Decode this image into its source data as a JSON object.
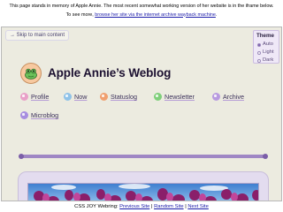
{
  "memorial": {
    "line1": "This page stands in memory of Apple Annie. The most recent somewhat working version of her website is in the iframe below.",
    "line2_prefix": "To see more, ",
    "line2_link": "browse her site via the internet archive wayback machine",
    "line2_suffix": "."
  },
  "site": {
    "skip_link": "Skip to main content",
    "title": "Apple Annie’s Weblog",
    "theme": {
      "title": "Theme",
      "options": [
        "Auto",
        "Light",
        "Dark"
      ],
      "selected": "Auto"
    },
    "nav": [
      {
        "label": "Profile",
        "icon": "profile-icon",
        "color": "#e9a0c8"
      },
      {
        "label": "Now",
        "icon": "now-icon",
        "color": "#8fc2e8"
      },
      {
        "label": "Statuslog",
        "icon": "statuslog-icon",
        "color": "#f0a070"
      },
      {
        "label": "Newsletter",
        "icon": "newsletter-icon",
        "color": "#7fcf7a"
      },
      {
        "label": "Archive",
        "icon": "archive-icon",
        "color": "#b89ae0"
      },
      {
        "label": "Microblog",
        "icon": "microblog-icon",
        "color": "#a88ee0"
      }
    ]
  },
  "webring": {
    "prefix": "CSS JOY Webring: ",
    "previous": "Previous Site",
    "sep1": " | ",
    "random": "Random Site",
    "sep2": " | ",
    "next": "Next Site"
  },
  "colors": {
    "frame_bg": "#ecebe0",
    "accent": "#9f86c4",
    "link": "#1a1aa8"
  }
}
